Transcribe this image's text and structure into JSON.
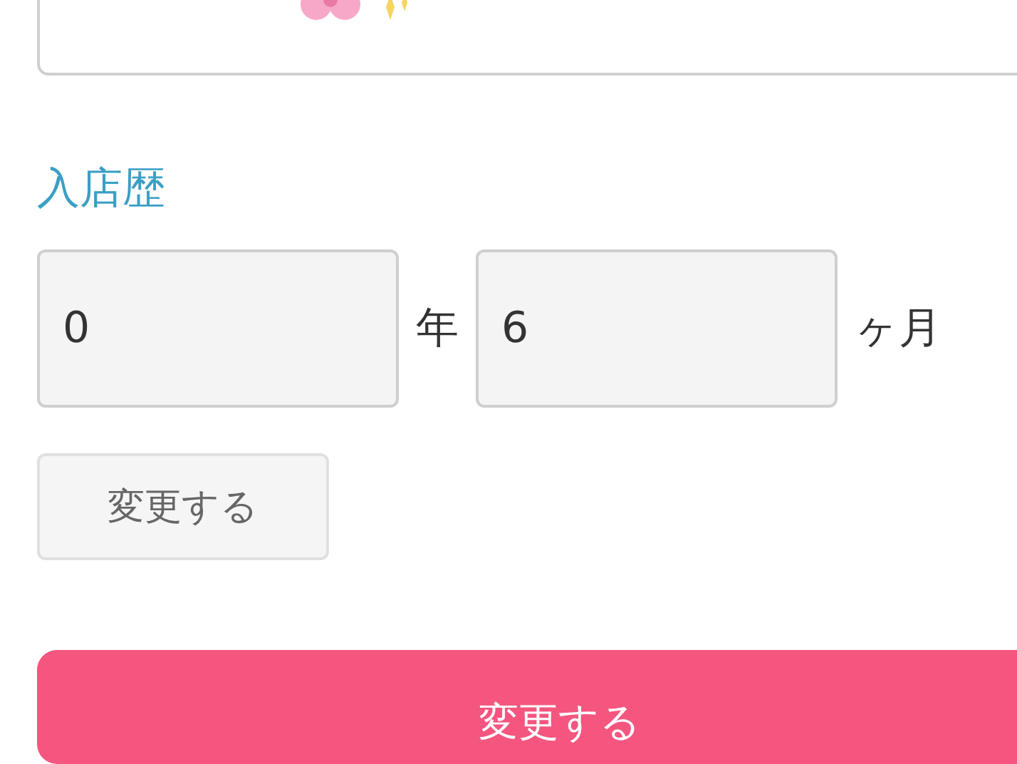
{
  "career": {
    "label": "入店歴",
    "years": {
      "value": "0",
      "unit": "年"
    },
    "months": {
      "value": "6",
      "unit": "ヶ月"
    },
    "button": "変更する"
  },
  "submit": {
    "label": "変更する"
  }
}
